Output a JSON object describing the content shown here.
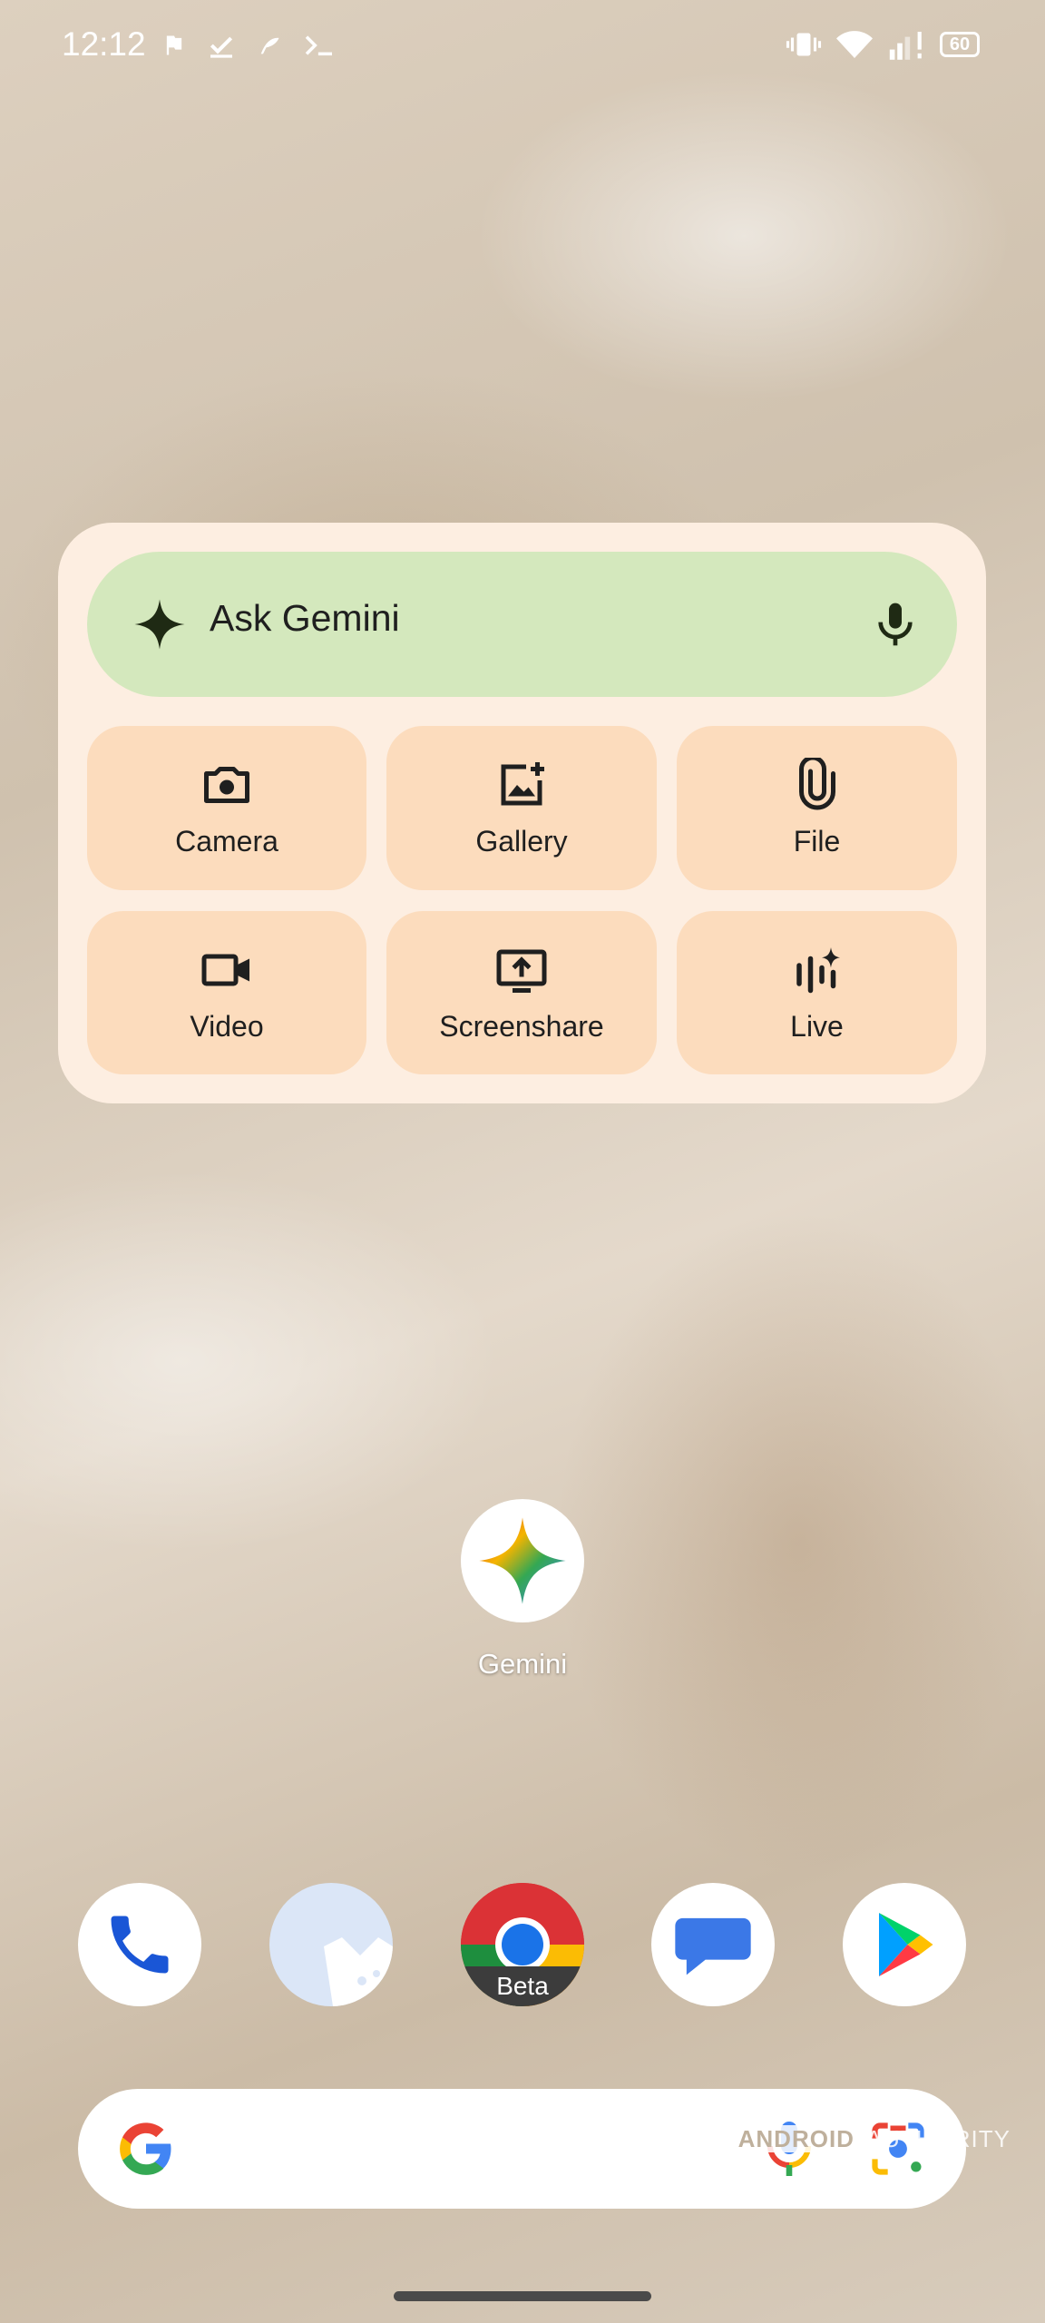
{
  "status_bar": {
    "time": "12:12",
    "battery": "60"
  },
  "gemini_widget": {
    "ask_label": "Ask Gemini",
    "tiles": [
      {
        "label": "Camera",
        "icon": "camera-icon"
      },
      {
        "label": "Gallery",
        "icon": "gallery-add-icon"
      },
      {
        "label": "File",
        "icon": "paperclip-icon"
      },
      {
        "label": "Video",
        "icon": "video-icon"
      },
      {
        "label": "Screenshare",
        "icon": "screenshare-icon"
      },
      {
        "label": "Live",
        "icon": "live-icon"
      }
    ]
  },
  "home": {
    "app_label": "Gemini"
  },
  "dock": {
    "apps": [
      "phone-icon",
      "wallpaper-app-icon",
      "chrome-beta-icon",
      "messages-icon",
      "play-store-icon"
    ],
    "chrome_badge": "Beta"
  },
  "search_bar": {
    "icons": [
      "google-g-icon",
      "voice-search-icon",
      "google-lens-icon"
    ]
  },
  "watermark": {
    "brand_bold": "ANDROID",
    "brand_light": "AUTHORITY"
  },
  "colors": {
    "widget_bg": "#fdeee1",
    "ask_bar_bg": "#d4e8bd",
    "tile_bg": "#fcdcbd"
  }
}
